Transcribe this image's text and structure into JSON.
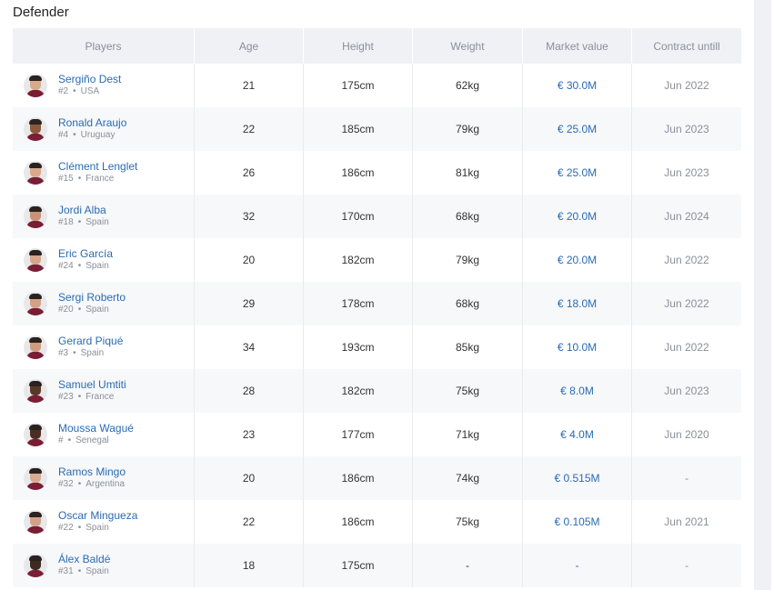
{
  "section_title": "Defender",
  "columns": {
    "players": "Players",
    "age": "Age",
    "height": "Height",
    "weight": "Weight",
    "market_value": "Market value",
    "contract": "Contract untill"
  },
  "separator": "•",
  "players": [
    {
      "name": "Sergiño Dest",
      "number": "#2",
      "country": "USA",
      "age": "21",
      "height": "175cm",
      "weight": "62kg",
      "value": "€ 30.0M",
      "contract": "Jun 2022",
      "skin": "#d9a98a"
    },
    {
      "name": "Ronald Araujo",
      "number": "#4",
      "country": "Uruguay",
      "age": "22",
      "height": "185cm",
      "weight": "79kg",
      "value": "€ 25.0M",
      "contract": "Jun 2023",
      "skin": "#8a5a3c"
    },
    {
      "name": "Clément Lenglet",
      "number": "#15",
      "country": "France",
      "age": "26",
      "height": "186cm",
      "weight": "81kg",
      "value": "€ 25.0M",
      "contract": "Jun 2023",
      "skin": "#d8a98c"
    },
    {
      "name": "Jordi Alba",
      "number": "#18",
      "country": "Spain",
      "age": "32",
      "height": "170cm",
      "weight": "68kg",
      "value": "€ 20.0M",
      "contract": "Jun 2024",
      "skin": "#c9937a"
    },
    {
      "name": "Eric García",
      "number": "#24",
      "country": "Spain",
      "age": "20",
      "height": "182cm",
      "weight": "79kg",
      "value": "€ 20.0M",
      "contract": "Jun 2022",
      "skin": "#d6a58a"
    },
    {
      "name": "Sergi Roberto",
      "number": "#20",
      "country": "Spain",
      "age": "29",
      "height": "178cm",
      "weight": "68kg",
      "value": "€ 18.0M",
      "contract": "Jun 2022",
      "skin": "#d3a184"
    },
    {
      "name": "Gerard Piqué",
      "number": "#3",
      "country": "Spain",
      "age": "34",
      "height": "193cm",
      "weight": "85kg",
      "value": "€ 10.0M",
      "contract": "Jun 2022",
      "skin": "#cf9c80"
    },
    {
      "name": "Samuel Umtiti",
      "number": "#23",
      "country": "France",
      "age": "28",
      "height": "182cm",
      "weight": "75kg",
      "value": "€ 8.0M",
      "contract": "Jun 2023",
      "skin": "#5a3828"
    },
    {
      "name": "Moussa Wagué",
      "number": "#",
      "country": "Senegal",
      "age": "23",
      "height": "177cm",
      "weight": "71kg",
      "value": "€ 4.0M",
      "contract": "Jun 2020",
      "skin": "#4a2e22"
    },
    {
      "name": "Ramos Mingo",
      "number": "#32",
      "country": "Argentina",
      "age": "20",
      "height": "186cm",
      "weight": "74kg",
      "value": "€ 0.515M",
      "contract": "-",
      "skin": "#d9ab90"
    },
    {
      "name": "Oscar Mingueza",
      "number": "#22",
      "country": "Spain",
      "age": "22",
      "height": "186cm",
      "weight": "75kg",
      "value": "€ 0.105M",
      "contract": "Jun 2021",
      "skin": "#d2a188"
    },
    {
      "name": "Álex Baldé",
      "number": "#31",
      "country": "Spain",
      "age": "18",
      "height": "175cm",
      "weight": "-",
      "value": "-",
      "contract": "-",
      "skin": "#3e2a20"
    }
  ]
}
